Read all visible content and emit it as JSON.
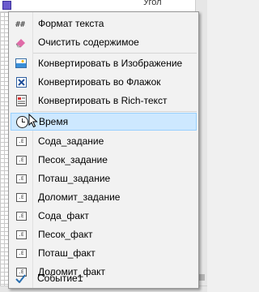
{
  "background": {
    "property_label": "Угол"
  },
  "menu": {
    "items": [
      {
        "label": "Формат текста",
        "icon": "text-format-icon"
      },
      {
        "label": "Очистить содержимое",
        "icon": "eraser-icon"
      },
      {
        "label": "Конвертировать в Изображение",
        "icon": "image-icon"
      },
      {
        "label": "Конвертировать во Флажок",
        "icon": "checkbox-icon"
      },
      {
        "label": "Конвертировать в Rich-текст",
        "icon": "rich-text-icon"
      },
      {
        "label": "Время",
        "icon": "clock-icon"
      },
      {
        "label": "Сода_задание",
        "icon": "field-icon"
      },
      {
        "label": "Песок_задание",
        "icon": "field-icon"
      },
      {
        "label": "Поташ_задание",
        "icon": "field-icon"
      },
      {
        "label": "Доломит_задание",
        "icon": "field-icon"
      },
      {
        "label": "Сода_факт",
        "icon": "field-icon"
      },
      {
        "label": "Песок_факт",
        "icon": "field-icon"
      },
      {
        "label": "Поташ_факт",
        "icon": "field-icon"
      },
      {
        "label": "Доломит_факт",
        "icon": "field-icon"
      },
      {
        "label": "Событие1",
        "icon": "check-icon"
      }
    ],
    "selected_index": 5
  },
  "colors": {
    "selection_bg": "#cde8ff",
    "selection_border": "#99d1ff",
    "menu_bg": "#f2f2f2"
  }
}
